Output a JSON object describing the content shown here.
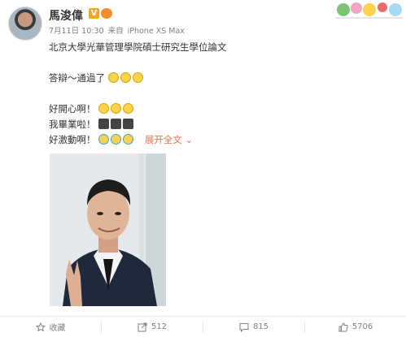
{
  "post": {
    "username": "馬浚偉",
    "verified_badge": "V",
    "meta": {
      "date": "7月11日 10:30",
      "source_prefix": "来自",
      "source": "iPhone XS Max"
    },
    "line1": "北京大學光華管理學院碩士研究生學位論文",
    "line2": "答辯～通過了",
    "line3": "好開心啊！",
    "line4": "我畢業啦！",
    "line5": "好激動啊！",
    "expand_label": "展开全文",
    "icons": {
      "line2_emojis": [
        "mask-emoji",
        "mask-emoji",
        "mask-emoji"
      ],
      "line3_emojis": [
        "smile-emoji",
        "smile-emoji",
        "smile-emoji"
      ],
      "line4_emojis": [
        "graduate-emoji",
        "graduate-emoji",
        "graduate-emoji"
      ],
      "line5_emojis": [
        "cry-emoji",
        "cry-emoji",
        "cry-emoji"
      ]
    }
  },
  "actions": {
    "favorite": "收藏",
    "repost": "512",
    "comment": "815",
    "like": "5706"
  },
  "colors": {
    "accent": "#eb7350",
    "muted": "#808080",
    "text": "#333333"
  }
}
